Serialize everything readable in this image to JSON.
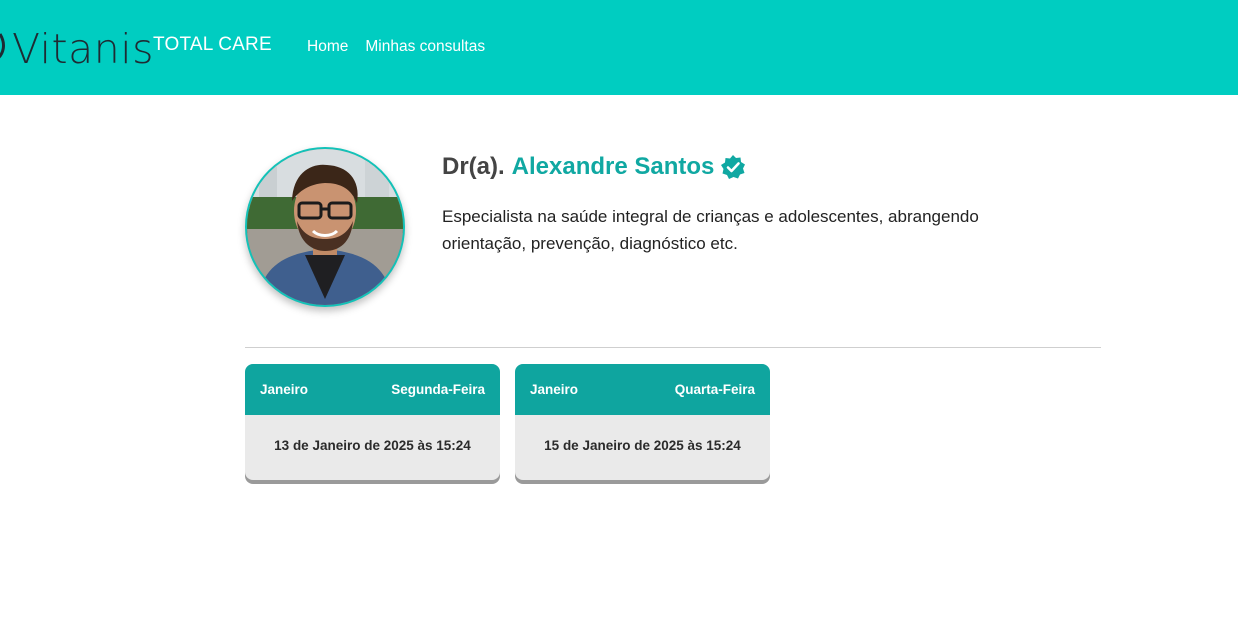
{
  "header": {
    "brand": "Vitanis",
    "tagline": "TOTAL CARE",
    "nav": [
      {
        "label": "Home"
      },
      {
        "label": "Minhas consultas"
      }
    ],
    "colors": {
      "background": "#00cdc1",
      "brand_text": "#1e2b33",
      "nav_text": "#ffffff"
    }
  },
  "doctor": {
    "prefix": "Dr(a).",
    "name": "Alexandre Santos",
    "verified_icon": "verified-badge-icon",
    "description": "Especialista na saúde integral de crianças e adolescentes, abrangendo orientação, prevenção, diagnóstico etc.",
    "accent": "#10a8a2"
  },
  "slots": [
    {
      "month": "Janeiro",
      "weekday": "Segunda-Feira",
      "datetime": "13 de Janeiro de 2025 às 15:24"
    },
    {
      "month": "Janeiro",
      "weekday": "Quarta-Feira",
      "datetime": "15 de Janeiro de 2025 às 15:24"
    }
  ]
}
